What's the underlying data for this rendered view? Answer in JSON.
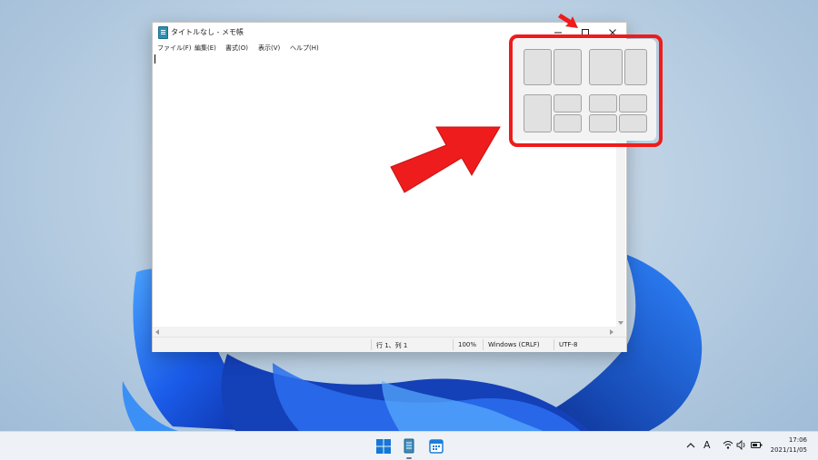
{
  "window": {
    "title": "タイトルなし - メモ帳",
    "menu": [
      "ファイル(F)",
      "編集(E)",
      "書式(O)",
      "表示(V)",
      "ヘルプ(H)"
    ],
    "status": {
      "position": "行 1、列 1",
      "zoom": "100%",
      "line_ending": "Windows (CRLF)",
      "encoding": "UTF-8"
    },
    "caption_buttons": [
      "minimize-icon",
      "maximize-icon",
      "close-icon"
    ]
  },
  "snap_layouts": [
    "two-columns",
    "wide-left-narrow-right",
    "one-left-two-right",
    "four-quadrants"
  ],
  "annotations": {
    "color": "#ee1c1c",
    "arrows": [
      "small-arrow-to-maximize",
      "large-arrow-to-snap-layouts"
    ]
  },
  "taskbar": {
    "pinned": [
      "windows-start-icon",
      "notepad-icon",
      "calendar-icon"
    ],
    "tray": {
      "ime": "A",
      "time": "17:06",
      "date": "2021/11/05"
    }
  }
}
